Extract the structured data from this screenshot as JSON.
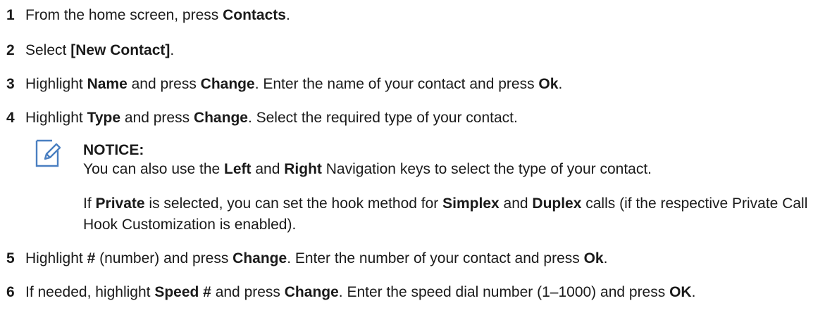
{
  "steps": [
    {
      "num": "1",
      "segments": [
        {
          "t": "From the home screen, press "
        },
        {
          "t": "Contacts",
          "b": true
        },
        {
          "t": "."
        }
      ]
    },
    {
      "num": "2",
      "segments": [
        {
          "t": "Select "
        },
        {
          "t": "[New Contact]",
          "b": true
        },
        {
          "t": "."
        }
      ]
    },
    {
      "num": "3",
      "segments": [
        {
          "t": "Highlight "
        },
        {
          "t": "Name",
          "b": true
        },
        {
          "t": " and press "
        },
        {
          "t": "Change",
          "b": true
        },
        {
          "t": ". Enter the name of your contact and press "
        },
        {
          "t": "Ok",
          "b": true
        },
        {
          "t": "."
        }
      ]
    },
    {
      "num": "4",
      "segments": [
        {
          "t": "Highlight "
        },
        {
          "t": "Type",
          "b": true
        },
        {
          "t": " and press "
        },
        {
          "t": "Change",
          "b": true
        },
        {
          "t": ". Select the required type of your contact."
        }
      ]
    },
    {
      "num": "5",
      "segments": [
        {
          "t": "Highlight "
        },
        {
          "t": "#",
          "b": true
        },
        {
          "t": " (number) and press "
        },
        {
          "t": "Change",
          "b": true
        },
        {
          "t": ". Enter the number of your contact and press "
        },
        {
          "t": "Ok",
          "b": true
        },
        {
          "t": "."
        }
      ]
    },
    {
      "num": "6",
      "segments": [
        {
          "t": "If needed, highlight "
        },
        {
          "t": "Speed #",
          "b": true
        },
        {
          "t": " and press "
        },
        {
          "t": "Change",
          "b": true
        },
        {
          "t": ". Enter the speed dial number (1–1000) and press "
        },
        {
          "t": "OK",
          "b": true
        },
        {
          "t": "."
        }
      ]
    }
  ],
  "notice": {
    "title": "NOTICE:",
    "icon": "pencil-note-icon",
    "icon_color": "#4a7fc1",
    "paragraphs": [
      [
        {
          "t": "You can also use the "
        },
        {
          "t": "Left",
          "b": true
        },
        {
          "t": " and "
        },
        {
          "t": "Right",
          "b": true
        },
        {
          "t": " Navigation keys to select the type of your contact."
        }
      ],
      [
        {
          "t": "If "
        },
        {
          "t": "Private",
          "b": true
        },
        {
          "t": " is selected, you can set the hook method for "
        },
        {
          "t": "Simplex",
          "b": true
        },
        {
          "t": " and "
        },
        {
          "t": "Duplex",
          "b": true
        },
        {
          "t": " calls (if the respective Private Call Hook Customization is enabled)."
        }
      ]
    ]
  }
}
